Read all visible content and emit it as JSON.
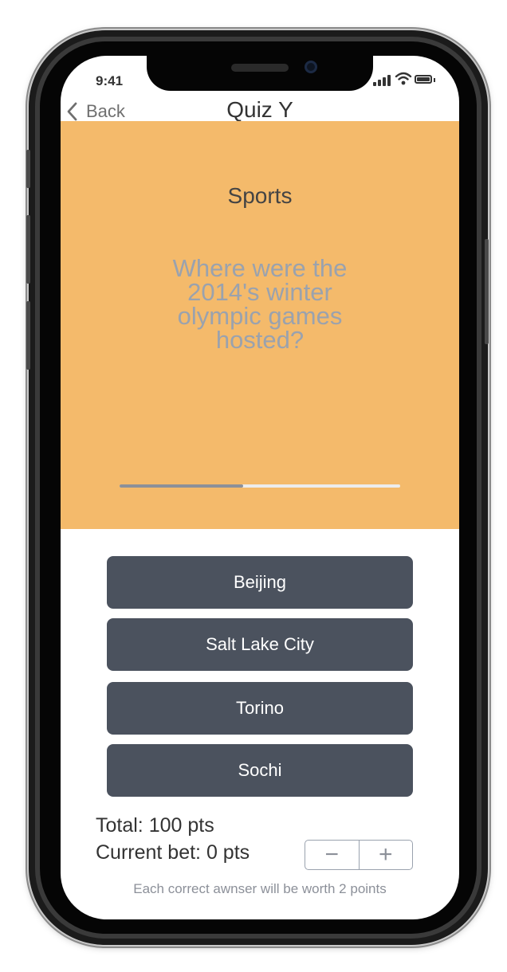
{
  "status_bar": {
    "time": "9:41",
    "signal_icon": "cellular-signal-icon",
    "wifi_icon": "wifi-icon",
    "battery_icon": "battery-icon"
  },
  "nav": {
    "back_icon": "chevron-left-icon",
    "back_label": "Back",
    "title": "Quiz Y"
  },
  "question_card": {
    "category": "Sports",
    "question": "Where were the 2014's winter olympic games hosted?",
    "progress": 0.44,
    "background_color": "#f4ba6b"
  },
  "answers": [
    {
      "label": "Beijing"
    },
    {
      "label": "Salt Lake City"
    },
    {
      "label": "Torino"
    },
    {
      "label": "Sochi"
    }
  ],
  "score": {
    "total_text": "Total: 100 pts",
    "bet_text": "Current bet: 0 pts",
    "decrement_label": "−",
    "increment_label": "+"
  },
  "footnote": "Each correct awnser will be worth 2 points",
  "colors": {
    "button": "#4b525e",
    "accent": "#f4ba6b",
    "muted_text": "#9aa2ae"
  }
}
